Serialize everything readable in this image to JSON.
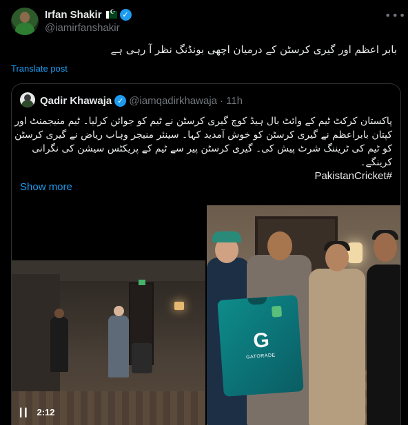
{
  "post": {
    "display_name": "Irfan Shakir",
    "flag_icon": "pakistan-flag-icon",
    "handle": "@iamirfanshakir",
    "text": "بابر اعظم اور گیری کرسٹن کے درمیان اچھی بونڈنگ نظر آ رہی ہے",
    "translate_label": "Translate post"
  },
  "quote": {
    "display_name": "Qadir Khawaja",
    "handle": "@iamqadirkhawaja",
    "separator": "·",
    "time": "11h",
    "text_lines": [
      "پاکستان کرکٹ ٹیم کے وائٹ بال ہیڈ کوچ گیری کرسٹن نے ٹیم کو جوائن کرلیا۔ ٹیم منیجمنٹ اور",
      "کپتان بابراعظم نے گیری کرسٹن کو خوش آمدید کہا۔ سینئر منیجر وہاب ریاض نے گیری کرسٹن",
      "کو ٹیم کی ٹریننگ شرٹ پیش کی۔ گیری کرسٹن پیر سے ٹیم کے پریکٹس سیشن کی نگرانی",
      "کرینگے۔"
    ],
    "hashtag": "#PakistanCricket",
    "show_more": "Show more",
    "video_duration": "2:12",
    "jersey_logo": "G",
    "jersey_text": "GATORADE"
  },
  "colors": {
    "background": "#000000",
    "accent": "#1d9bf0",
    "secondary_text": "#71767b",
    "border": "#2f3336"
  }
}
